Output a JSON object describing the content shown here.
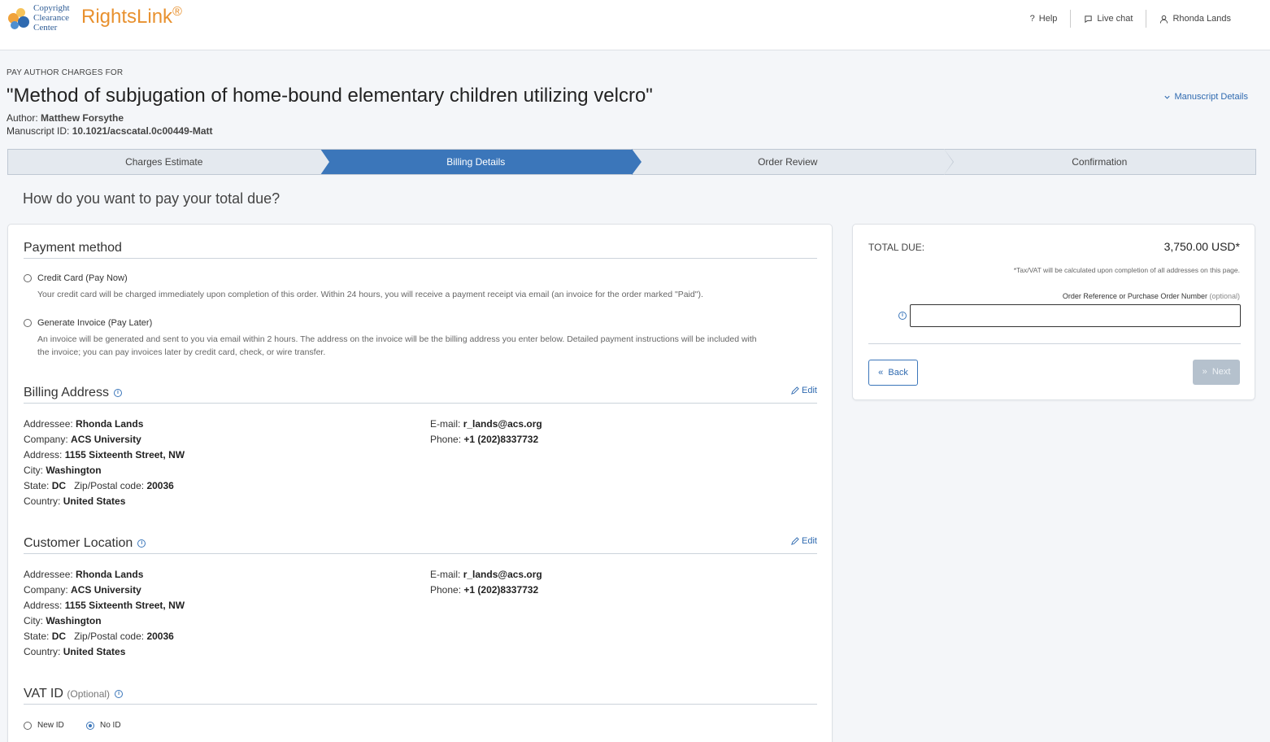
{
  "header": {
    "logo_lines": [
      "Copyright",
      "Clearance",
      "Center"
    ],
    "brand": "RightsLink",
    "brand_mark": "®",
    "nav": [
      {
        "label": "Help",
        "icon": "question-icon"
      },
      {
        "label": "Live chat",
        "icon": "chat-icon"
      },
      {
        "label": "Rhonda Lands",
        "icon": "user-icon"
      }
    ]
  },
  "page": {
    "pre_title": "PAY AUTHOR CHARGES FOR",
    "title": "\"Method of subjugation of home-bound elementary children utilizing velcro\"",
    "author_label": "Author:",
    "author": "Matthew Forsythe",
    "manuscript_label": "Manuscript ID:",
    "manuscript_id": "10.1021/acscatal.0c00449-Matt",
    "manuscript_details_link": "Manuscript Details"
  },
  "steps": [
    "Charges Estimate",
    "Billing Details",
    "Order Review",
    "Confirmation"
  ],
  "active_step": "Billing Details",
  "question": "How do you want to pay your total due?",
  "payment": {
    "title": "Payment method",
    "options": [
      {
        "label": "Credit Card (Pay Now)",
        "help": "Your credit card will be charged immediately upon completion of this order. Within 24 hours, you will receive a payment receipt via email (an invoice for the order marked \"Paid\")."
      },
      {
        "label": "Generate Invoice (Pay Later)",
        "help_line1": "An invoice will be generated and sent to you via email within 2 hours. The address on the invoice will be the billing address you enter below. Detailed payment instructions will be included with",
        "help_line2": "the invoice; you can pay invoices later by credit card, check, or wire transfer."
      }
    ]
  },
  "billing": {
    "title": "Billing Address",
    "edit": "Edit",
    "addressee_label": "Addressee:",
    "addressee": "Rhonda Lands",
    "company_label": "Company:",
    "company": "ACS University",
    "address_label": "Address:",
    "address": "1155 Sixteenth Street, NW",
    "city_label": "City:",
    "city": "Washington",
    "state_label": "State:",
    "state": "DC",
    "zip_label": "Zip/Postal code:",
    "zip": "20036",
    "country_label": "Country:",
    "country": "United States",
    "email_label": "E-mail:",
    "email": "r_lands@acs.org",
    "phone_label": "Phone:",
    "phone": "+1 (202)8337732"
  },
  "customer": {
    "title": "Customer Location",
    "edit": "Edit",
    "addressee_label": "Addressee:",
    "addressee": "Rhonda Lands",
    "company_label": "Company:",
    "company": "ACS University",
    "address_label": "Address:",
    "address": "1155 Sixteenth Street, NW",
    "city_label": "City:",
    "city": "Washington",
    "state_label": "State:",
    "state": "DC",
    "zip_label": "Zip/Postal code:",
    "zip": "20036",
    "country_label": "Country:",
    "country": "United States",
    "email_label": "E-mail:",
    "email": "r_lands@acs.org",
    "phone_label": "Phone:",
    "phone": "+1 (202)8337732"
  },
  "vat": {
    "title": "VAT ID",
    "optional": "(Optional)",
    "options": [
      "New ID",
      "No ID"
    ],
    "selected": "No ID"
  },
  "summary": {
    "total_label": "TOTAL DUE:",
    "total_value": "3,750.00 USD*",
    "tax_note": "*Tax/VAT will be calculated upon completion of all addresses on this page.",
    "po_label": "Order Reference or Purchase Order Number",
    "po_optional": "(optional)",
    "po_value": "",
    "back": "Back",
    "next": "Next"
  },
  "colors": {
    "accent": "#3b76ba",
    "brand": "#e8912f",
    "disabled_button": "#b5c1cd"
  }
}
